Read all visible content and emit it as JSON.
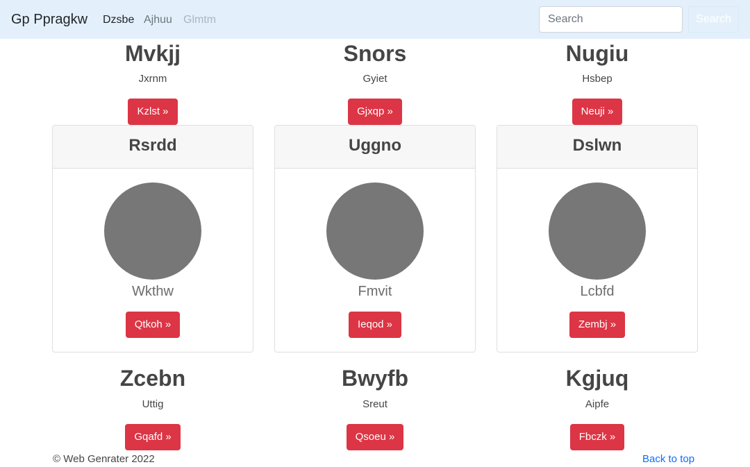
{
  "navbar": {
    "brand": "Gp Ppragkw",
    "links": [
      "Dzsbe",
      "Ajhuu",
      "Glmtm"
    ],
    "search_placeholder": "Search",
    "search_button": "Search"
  },
  "top_row": [
    {
      "title": "Mvkjj",
      "text": "Jxrnm",
      "button": "Kzlst »"
    },
    {
      "title": "Snors",
      "text": "Gyiet",
      "button": "Gjxqp »"
    },
    {
      "title": "Nugiu",
      "text": "Hsbep",
      "button": "Neuji »"
    }
  ],
  "cards": [
    {
      "header": "Rsrdd",
      "subtitle": "Wkthw",
      "button": "Qtkoh »"
    },
    {
      "header": "Uggno",
      "subtitle": "Fmvit",
      "button": "Ieqod »"
    },
    {
      "header": "Dslwn",
      "subtitle": "Lcbfd",
      "button": "Zembj »"
    }
  ],
  "bottom_row": [
    {
      "title": "Zcebn",
      "text": "Uttig",
      "button": "Gqafd »"
    },
    {
      "title": "Bwyfb",
      "text": "Sreut",
      "button": "Qsoeu »"
    },
    {
      "title": "Kgjuq",
      "text": "Aipfe",
      "button": "Fbczk »"
    }
  ],
  "footer": {
    "copyright": "© Web Genrater 2022",
    "back_to_top": "Back to top"
  },
  "colors": {
    "navbar_bg": "#e3f0fb",
    "button_red": "#dc3545",
    "avatar_gray": "#777777",
    "link_blue": "#0d6efd"
  }
}
